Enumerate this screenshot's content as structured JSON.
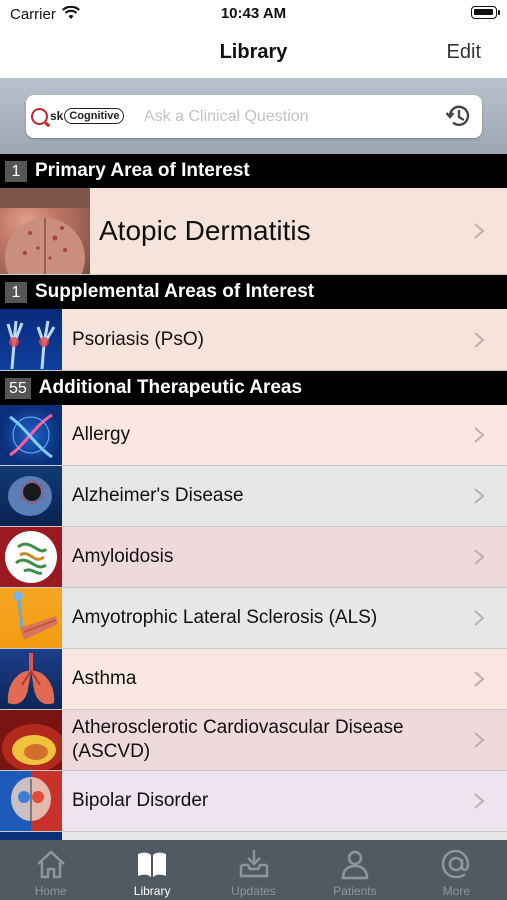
{
  "status_bar": {
    "carrier": "Carrier",
    "time": "10:43 AM"
  },
  "nav": {
    "title": "Library",
    "edit_label": "Edit"
  },
  "search": {
    "logo_ask": "sk",
    "logo_cognitive": "Cognitive",
    "placeholder": "Ask a Clinical Question"
  },
  "sections": {
    "primary": {
      "count": "1",
      "title": "Primary Area of Interest"
    },
    "supplemental": {
      "count": "1",
      "title": "Supplemental Areas of Interest"
    },
    "additional": {
      "count": "55",
      "title": "Additional Therapeutic Areas"
    }
  },
  "primary_item": {
    "label": "Atopic Dermatitis",
    "bg": "#f6e4dc"
  },
  "supplemental_items": [
    {
      "label": "Psoriasis (PsO)",
      "bg": "#f6e4dc"
    }
  ],
  "additional_items": [
    {
      "label": "Allergy",
      "bg": "#fbe7e1"
    },
    {
      "label": "Alzheimer's Disease",
      "bg": "#e7e7e7"
    },
    {
      "label": "Amyloidosis",
      "bg": "#eed9dd"
    },
    {
      "label": "Amyotrophic Lateral Sclerosis (ALS)",
      "bg": "#e7e7e7"
    },
    {
      "label": "Asthma",
      "bg": "#fbe7e1"
    },
    {
      "label": "Atherosclerotic Cardiovascular Disease (ASCVD)",
      "bg": "#eed9dd"
    },
    {
      "label": "Bipolar Disorder",
      "bg": "#ede4ef"
    }
  ],
  "tabs": [
    {
      "label": "Home",
      "icon": "home-icon",
      "active": false
    },
    {
      "label": "Library",
      "icon": "book-icon",
      "active": true
    },
    {
      "label": "Updates",
      "icon": "inbox-download-icon",
      "active": false
    },
    {
      "label": "Patients",
      "icon": "person-icon",
      "active": false
    },
    {
      "label": "More",
      "icon": "at-sign-icon",
      "active": false
    }
  ]
}
